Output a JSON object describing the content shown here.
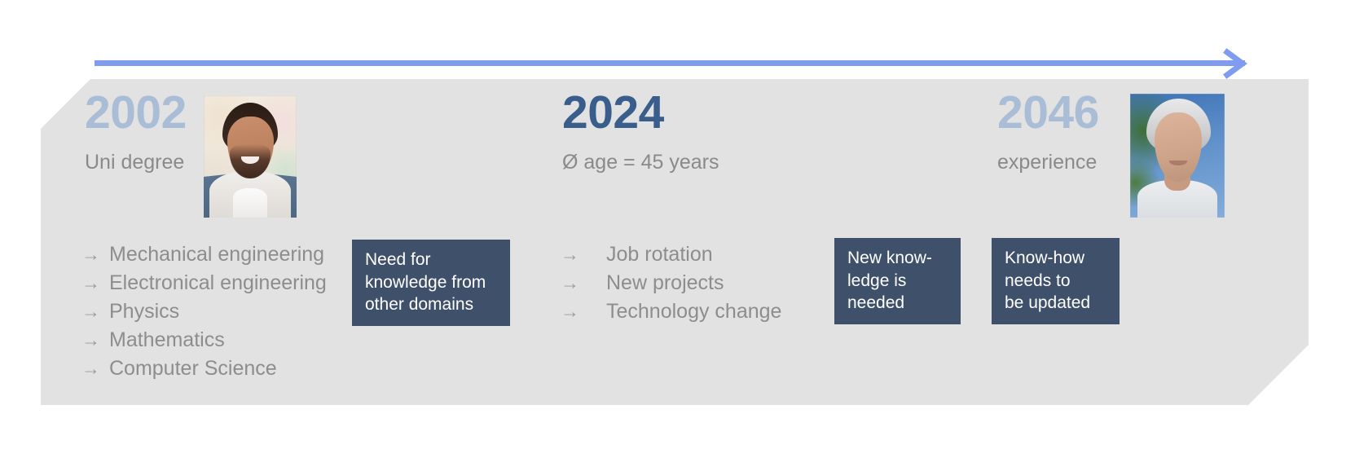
{
  "colors": {
    "banner_bg": "#e2e2e2",
    "page_bg": "#ffffff",
    "arrow_blue": "#7f9cf0",
    "year_muted": "#a9bdd6",
    "year_strong": "#3a5e8c",
    "body_gray": "#8d8d8d",
    "callout_bg": "#3f506b",
    "callout_text": "#ffffff"
  },
  "timeline_arrow": {
    "direction": "left-to-right",
    "icon": "arrow-right-icon"
  },
  "columns": [
    {
      "id": "2002",
      "year": "2002",
      "year_emphasis": "muted",
      "subtitle": "Uni degree",
      "portrait": {
        "icon": "portrait-photo",
        "alt": "young man smiling"
      },
      "bullets": [
        {
          "marker": "→",
          "label": "Mechanical engineering"
        },
        {
          "marker": "→",
          "label": "Electronical engineering"
        },
        {
          "marker": "→",
          "label": "Physics"
        },
        {
          "marker": "→",
          "label": "Mathematics"
        },
        {
          "marker": "→",
          "label": "Computer Science"
        }
      ],
      "callouts": [
        {
          "id": "need-for-knowledge",
          "lines": [
            "Need for",
            "knowledge from",
            "other domains"
          ]
        }
      ]
    },
    {
      "id": "2024",
      "year": "2024",
      "year_emphasis": "strong",
      "subtitle": "Ø age = 45 years",
      "portrait": null,
      "bullets": [
        {
          "marker": "→",
          "label": "Job rotation"
        },
        {
          "marker": "→",
          "label": "New projects"
        },
        {
          "marker": "→",
          "label": "Technology change"
        }
      ],
      "callouts": [
        {
          "id": "new-knowledge-needed",
          "lines": [
            "New know-",
            "ledge is",
            "needed"
          ]
        },
        {
          "id": "know-how-updated",
          "lines": [
            "Know-how",
            "needs to",
            "be updated"
          ]
        }
      ]
    },
    {
      "id": "2046",
      "year": "2046",
      "year_emphasis": "muted",
      "subtitle": "experience",
      "portrait": {
        "icon": "portrait-photo",
        "alt": "older woman outdoors"
      },
      "bullets": [],
      "callouts": []
    }
  ]
}
